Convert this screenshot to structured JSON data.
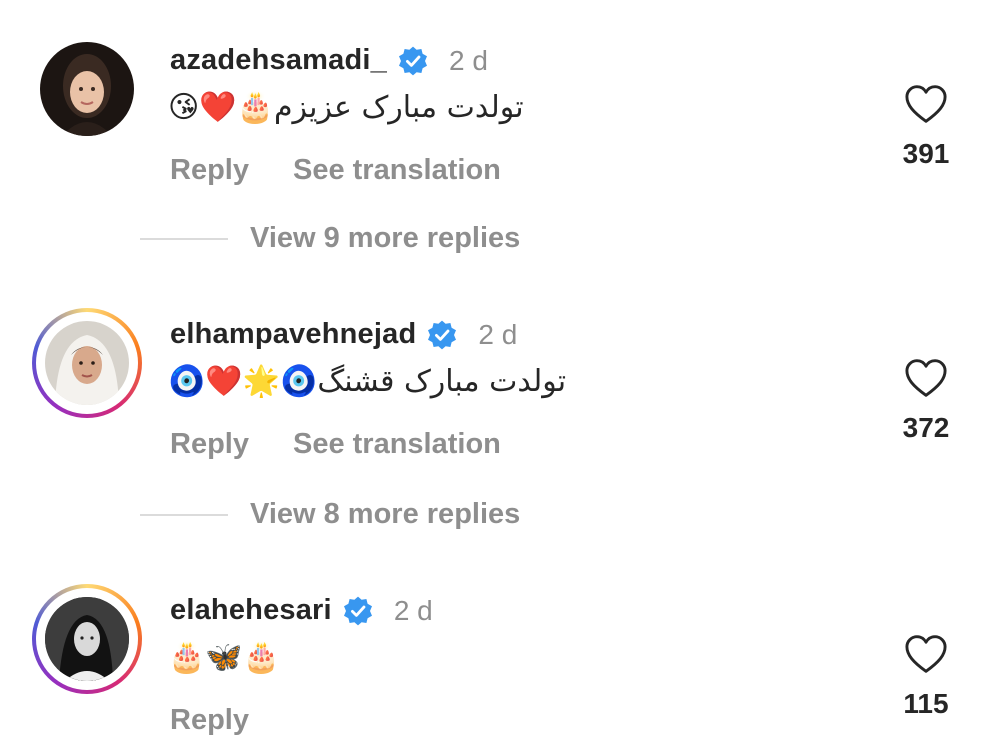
{
  "comments": [
    {
      "username": "azadehsamadi_",
      "time": "2 d",
      "text": "تولدت مبارک عزیزم🎂❤️😘",
      "reply_label": "Reply",
      "translate_label": "See translation",
      "likes": "391",
      "view_replies": "View 9 more replies"
    },
    {
      "username": "elhampavehnejad",
      "time": "2 d",
      "text": "تولدت مبارک قشنگ🧿🌟❤️🧿",
      "reply_label": "Reply",
      "translate_label": "See translation",
      "likes": "372",
      "view_replies": "View 8 more replies"
    },
    {
      "username": "elahehesari",
      "time": "2 d",
      "text": "🎂🦋🎂",
      "reply_label": "Reply",
      "likes": "115"
    }
  ],
  "colors": {
    "verified": "#3897f0",
    "muted": "#8e8e8e",
    "text": "#262626"
  },
  "icons": {
    "verified": "verified-badge-icon",
    "like": "heart-outline-icon"
  }
}
